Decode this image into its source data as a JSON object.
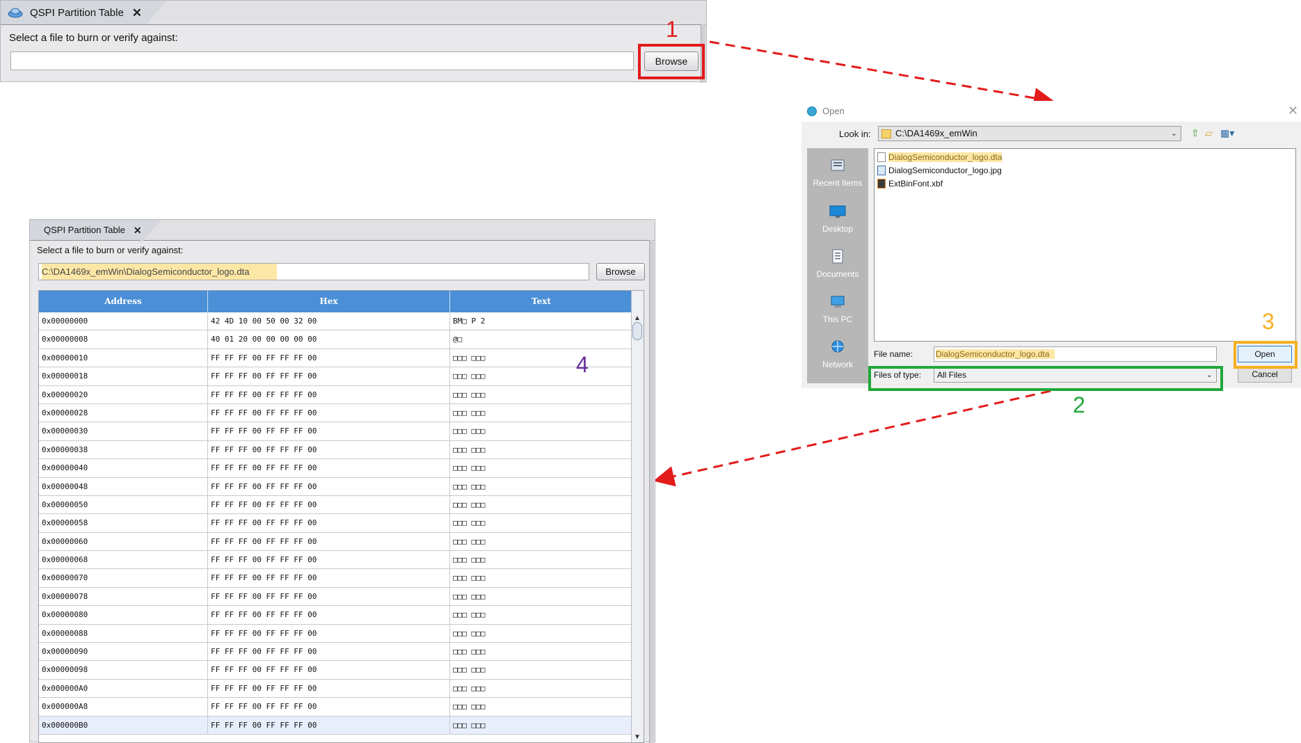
{
  "colors": {
    "annotation_1": "#e31b1b",
    "annotation_2": "#1fa83a",
    "annotation_3": "#f5b022",
    "annotation_4": "#6a2f9b",
    "table_header": "#4b8fd6",
    "selection_highlight": "#fde7a6"
  },
  "top_panel": {
    "tab_title": "QSPI Partition Table",
    "prompt": "Select a file to burn or verify against:",
    "path_value": "",
    "browse_label": "Browse"
  },
  "bottom_panel": {
    "tab_title": "QSPI Partition Table",
    "prompt": "Select a file to burn or verify against:",
    "path_value": "C:\\DA1469x_emWin\\DialogSemiconductor_logo.dta",
    "browse_label": "Browse",
    "table": {
      "columns": [
        "Address",
        "Hex",
        "Text"
      ],
      "rows": [
        {
          "address": "0x00000000",
          "hex": "42 4D 10 00 50 00 32 00",
          "text": "BM□ P 2"
        },
        {
          "address": "0x00000008",
          "hex": "40 01 20 00 00 00 00 00",
          "text": "@□"
        },
        {
          "address": "0x00000010",
          "hex": "FF FF FF 00 FF FF FF 00",
          "text": "□□□ □□□"
        },
        {
          "address": "0x00000018",
          "hex": "FF FF FF 00 FF FF FF 00",
          "text": "□□□ □□□"
        },
        {
          "address": "0x00000020",
          "hex": "FF FF FF 00 FF FF FF 00",
          "text": "□□□ □□□"
        },
        {
          "address": "0x00000028",
          "hex": "FF FF FF 00 FF FF FF 00",
          "text": "□□□ □□□"
        },
        {
          "address": "0x00000030",
          "hex": "FF FF FF 00 FF FF FF 00",
          "text": "□□□ □□□"
        },
        {
          "address": "0x00000038",
          "hex": "FF FF FF 00 FF FF FF 00",
          "text": "□□□ □□□"
        },
        {
          "address": "0x00000040",
          "hex": "FF FF FF 00 FF FF FF 00",
          "text": "□□□ □□□"
        },
        {
          "address": "0x00000048",
          "hex": "FF FF FF 00 FF FF FF 00",
          "text": "□□□ □□□"
        },
        {
          "address": "0x00000050",
          "hex": "FF FF FF 00 FF FF FF 00",
          "text": "□□□ □□□"
        },
        {
          "address": "0x00000058",
          "hex": "FF FF FF 00 FF FF FF 00",
          "text": "□□□ □□□"
        },
        {
          "address": "0x00000060",
          "hex": "FF FF FF 00 FF FF FF 00",
          "text": "□□□ □□□"
        },
        {
          "address": "0x00000068",
          "hex": "FF FF FF 00 FF FF FF 00",
          "text": "□□□ □□□"
        },
        {
          "address": "0x00000070",
          "hex": "FF FF FF 00 FF FF FF 00",
          "text": "□□□ □□□"
        },
        {
          "address": "0x00000078",
          "hex": "FF FF FF 00 FF FF FF 00",
          "text": "□□□ □□□"
        },
        {
          "address": "0x00000080",
          "hex": "FF FF FF 00 FF FF FF 00",
          "text": "□□□ □□□"
        },
        {
          "address": "0x00000088",
          "hex": "FF FF FF 00 FF FF FF 00",
          "text": "□□□ □□□"
        },
        {
          "address": "0x00000090",
          "hex": "FF FF FF 00 FF FF FF 00",
          "text": "□□□ □□□"
        },
        {
          "address": "0x00000098",
          "hex": "FF FF FF 00 FF FF FF 00",
          "text": "□□□ □□□"
        },
        {
          "address": "0x000000A0",
          "hex": "FF FF FF 00 FF FF FF 00",
          "text": "□□□ □□□"
        },
        {
          "address": "0x000000A8",
          "hex": "FF FF FF 00 FF FF FF 00",
          "text": "□□□ □□□"
        },
        {
          "address": "0x000000B0",
          "hex": "FF FF FF 00 FF FF FF 00",
          "text": "□□□ □□□"
        }
      ]
    }
  },
  "open_dialog": {
    "title": "Open",
    "look_in_label": "Look in:",
    "look_in_value": "C:\\DA1469x_emWin",
    "places": [
      {
        "label": "Recent Items",
        "icon": "recent-items-icon"
      },
      {
        "label": "Desktop",
        "icon": "desktop-icon"
      },
      {
        "label": "Documents",
        "icon": "documents-icon"
      },
      {
        "label": "This PC",
        "icon": "this-pc-icon"
      },
      {
        "label": "Network",
        "icon": "network-icon"
      }
    ],
    "files": [
      {
        "name": "DialogSemiconductor_logo.dta",
        "icon": "file-icon",
        "selected": true
      },
      {
        "name": "DialogSemiconductor_logo.jpg",
        "icon": "image-file-icon",
        "selected": false
      },
      {
        "name": "ExtBinFont.xbf",
        "icon": "font-file-icon",
        "selected": false
      }
    ],
    "file_name_label": "File name:",
    "file_name_value": "DialogSemiconductor_logo.dta",
    "files_of_type_label": "Files of type:",
    "files_of_type_value": "All Files",
    "open_label": "Open",
    "cancel_label": "Cancel"
  },
  "annotations": {
    "step1": "1",
    "step2": "2",
    "step3": "3",
    "step4": "4"
  }
}
